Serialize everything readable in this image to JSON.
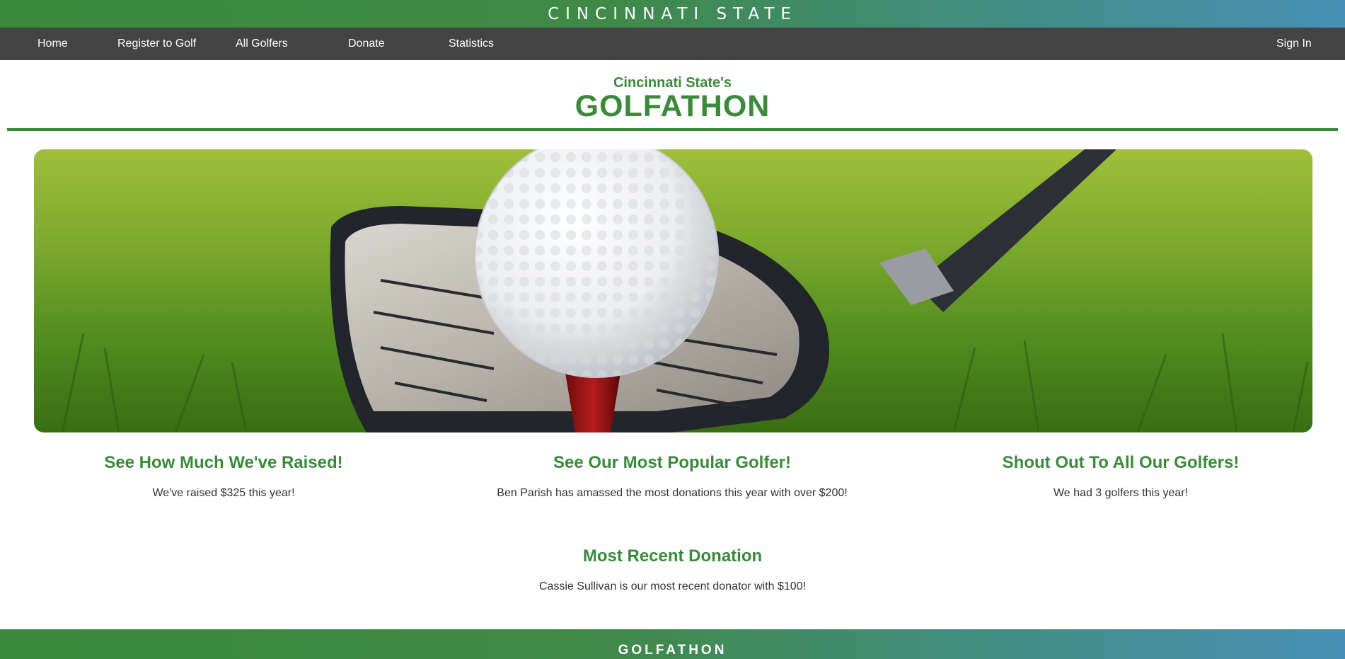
{
  "brand": {
    "name": "CINCINNATI STATE"
  },
  "nav": {
    "items": [
      {
        "label": "Home"
      },
      {
        "label": "Register to Golf"
      },
      {
        "label": "All Golfers"
      },
      {
        "label": "Donate"
      },
      {
        "label": "Statistics"
      }
    ],
    "sign_in": "Sign In"
  },
  "header": {
    "subtitle": "Cincinnati State's",
    "title": "GOLFATHON"
  },
  "hero": {
    "image": "golf-ball-on-tee-with-driver"
  },
  "features": [
    {
      "heading": "See How Much We've Raised!",
      "text": "We've raised $325 this year!"
    },
    {
      "heading": "See Our Most Popular Golfer!",
      "text": "Ben Parish has amassed the most donations this year with over $200!"
    },
    {
      "heading": "Shout Out To All Our Golfers!",
      "text": "We had 3 golfers this year!"
    }
  ],
  "recent": {
    "heading": "Most Recent Donation",
    "text": "Cassie Sullivan is our most recent donator with $100!"
  },
  "footer": {
    "text": "GOLFATHON"
  },
  "colors": {
    "brand_green": "#3b8a3b",
    "nav_bg": "#444444",
    "gradient_end": "#4791b7"
  }
}
